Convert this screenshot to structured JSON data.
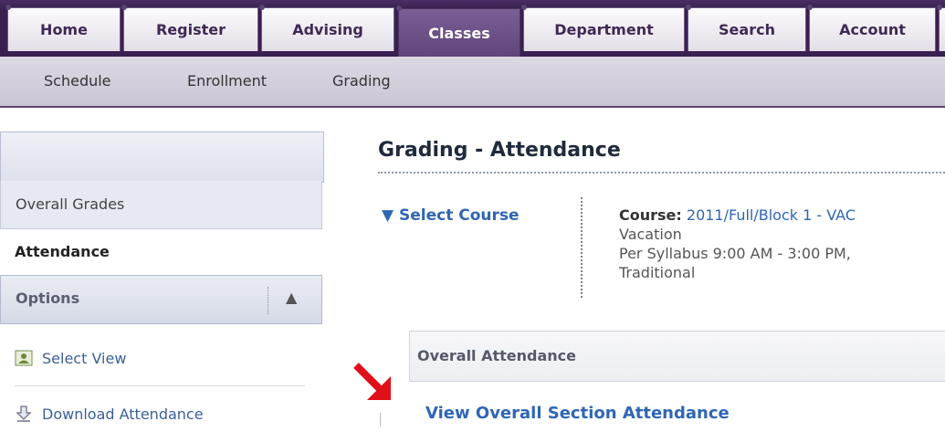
{
  "nav": {
    "tabs": [
      {
        "label": "Home"
      },
      {
        "label": "Register"
      },
      {
        "label": "Advising"
      },
      {
        "label": "Classes",
        "active": true
      },
      {
        "label": "Department"
      },
      {
        "label": "Search"
      },
      {
        "label": "Account"
      }
    ],
    "subtabs": [
      "Schedule",
      "Enrollment",
      "Grading"
    ]
  },
  "sidebar": {
    "items": [
      "Overall Grades",
      "Attendance"
    ],
    "active_item": "Attendance",
    "options": {
      "label": "Options",
      "toggle_icon": "▲",
      "links": [
        {
          "label": "Select View",
          "icon": "select-view-icon"
        },
        {
          "label": "Download Attendance",
          "icon": "download-icon"
        }
      ]
    }
  },
  "main": {
    "title": "Grading - Attendance",
    "select_course": "▼ Select Course",
    "course": {
      "label": "Course:",
      "value": "2011/Full/Block 1 - VAC",
      "line2": "Vacation",
      "line3": "Per Syllabus 9:00 AM - 3:00 PM,",
      "line4": "Traditional"
    },
    "panel_title": "Overall Attendance",
    "view_link": "View Overall Section Attendance"
  },
  "colors": {
    "brand_purple": "#3a2050",
    "active_tab": "#6a4f86",
    "link_blue": "#2f66b3",
    "annotation_arrow": "#e0101a"
  }
}
